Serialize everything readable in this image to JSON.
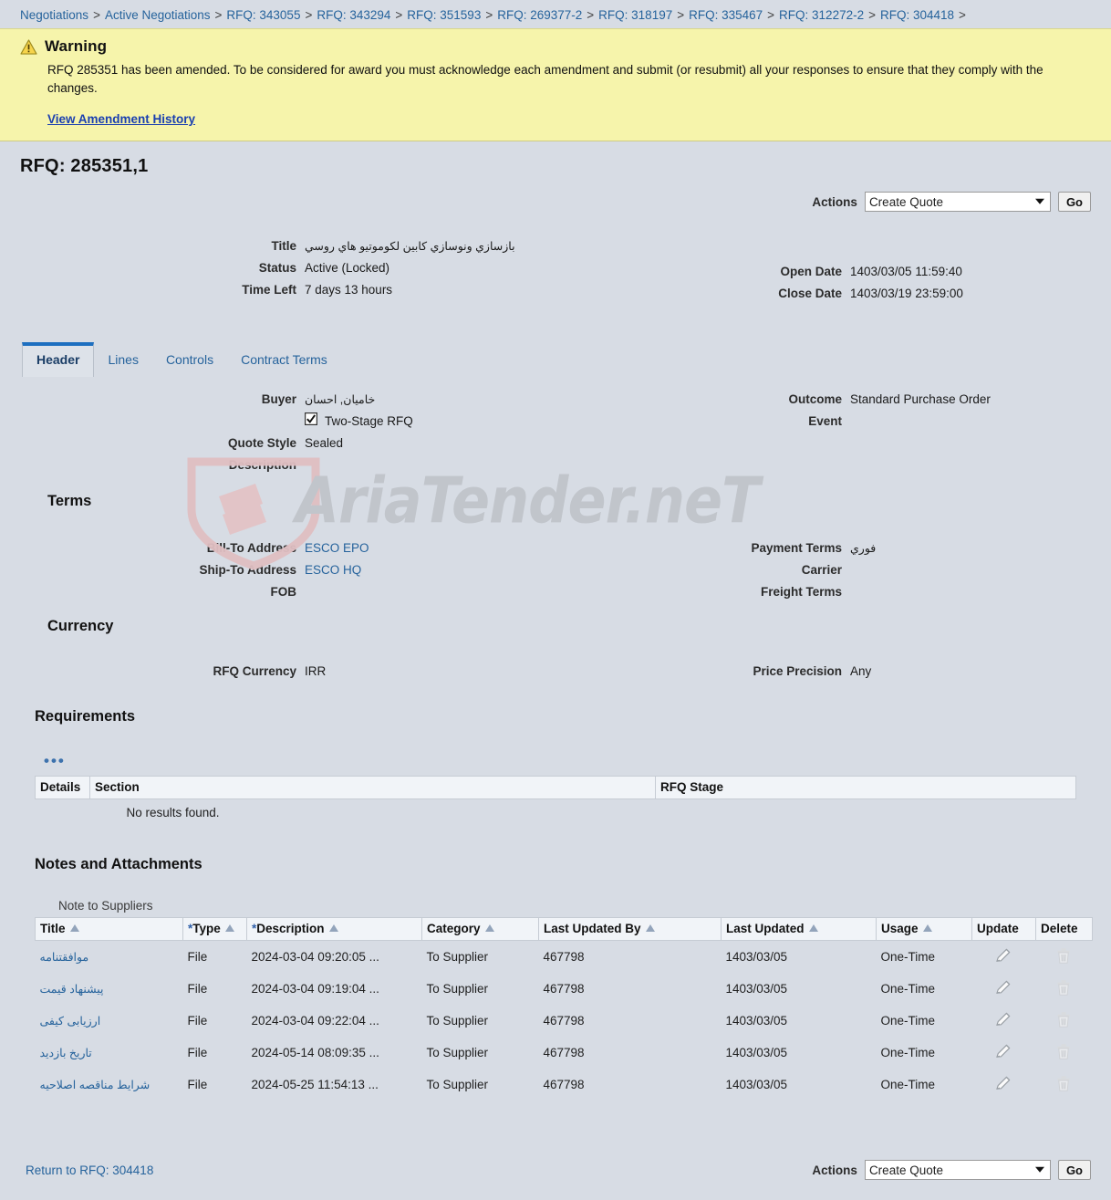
{
  "breadcrumb": {
    "separator": ">",
    "items": [
      "Negotiations",
      "Active Negotiations",
      "RFQ: 343055",
      "RFQ: 343294",
      "RFQ: 351593",
      "RFQ: 269377-2",
      "RFQ: 318197",
      "RFQ: 335467",
      "RFQ: 312272-2",
      "RFQ: 304418"
    ]
  },
  "warning": {
    "icon": "warning-triangle-icon",
    "title": "Warning",
    "message": "RFQ 285351 has been amended. To be considered for award you must acknowledge each amendment and submit (or resubmit) all your responses to ensure that they comply with the changes.",
    "link": "View Amendment History",
    "bg_color": "#f6f4ab"
  },
  "page": {
    "title": "RFQ: 285351,1",
    "bg_color": "#d7dce4",
    "link_color": "#26639c",
    "accent_color": "#1d6fc0"
  },
  "actions_top": {
    "label": "Actions",
    "selected": "Create Quote",
    "options": [
      "Create Quote"
    ],
    "go_label": "Go"
  },
  "actions_bottom": {
    "label": "Actions",
    "selected": "Create Quote",
    "options": [
      "Create Quote"
    ],
    "go_label": "Go"
  },
  "summary": {
    "left": [
      {
        "label": "Title",
        "value": "بازسازي ونوسازي كابين لكوموتيو هاي روسي",
        "rtl": true
      },
      {
        "label": "Status",
        "value": "Active (Locked)",
        "rtl": false
      },
      {
        "label": "Time Left",
        "value": "7 days 13 hours",
        "rtl": false
      }
    ],
    "right": [
      {
        "label": "Open Date",
        "value": "1403/03/05 11:59:40"
      },
      {
        "label": "Close Date",
        "value": "1403/03/19 23:59:00"
      }
    ]
  },
  "tabs": [
    {
      "label": "Header",
      "active": true
    },
    {
      "label": "Lines",
      "active": false
    },
    {
      "label": "Controls",
      "active": false
    },
    {
      "label": "Contract Terms",
      "active": false
    }
  ],
  "header_tab": {
    "left": [
      {
        "label": "Buyer",
        "value": "خامیان, احسان",
        "rtl": true
      },
      {
        "label": "Quote Style",
        "value": "Sealed",
        "rtl": false
      },
      {
        "label": "Description",
        "value": "",
        "rtl": false
      }
    ],
    "two_stage": {
      "label": "Two-Stage RFQ",
      "checked": true
    },
    "right": [
      {
        "label": "Outcome",
        "value": "Standard Purchase Order"
      },
      {
        "label": "Event",
        "value": ""
      }
    ]
  },
  "terms": {
    "heading": "Terms",
    "left": [
      {
        "label": "Bill-To Address",
        "value": "ESCO EPO",
        "link": true
      },
      {
        "label": "Ship-To Address",
        "value": "ESCO HQ",
        "link": true
      },
      {
        "label": "FOB",
        "value": "",
        "link": false
      }
    ],
    "right": [
      {
        "label": "Payment Terms",
        "value": "فوري",
        "rtl": true
      },
      {
        "label": "Carrier",
        "value": "",
        "rtl": false
      },
      {
        "label": "Freight Terms",
        "value": "",
        "rtl": false
      }
    ]
  },
  "currency": {
    "heading": "Currency",
    "left": [
      {
        "label": "RFQ Currency",
        "value": "IRR"
      }
    ],
    "right": [
      {
        "label": "Price Precision",
        "value": "Any"
      }
    ]
  },
  "requirements": {
    "heading": "Requirements",
    "more_icon": "ellipsis-icon",
    "columns": [
      "Details",
      "Section",
      "RFQ Stage"
    ],
    "empty_text": "No results found."
  },
  "notes": {
    "heading": "Notes and Attachments",
    "subheading": "Note to Suppliers",
    "columns": [
      {
        "label": "Title",
        "sortable": true,
        "required": false
      },
      {
        "label": "Type",
        "sortable": true,
        "required": true
      },
      {
        "label": "Description",
        "sortable": true,
        "required": true
      },
      {
        "label": "Category",
        "sortable": true,
        "required": false
      },
      {
        "label": "Last Updated By",
        "sortable": true,
        "required": false
      },
      {
        "label": "Last Updated",
        "sortable": true,
        "required": false
      },
      {
        "label": "Usage",
        "sortable": true,
        "required": false
      },
      {
        "label": "Update",
        "sortable": false,
        "required": false
      },
      {
        "label": "Delete",
        "sortable": false,
        "required": false
      }
    ],
    "rows": [
      {
        "title": "موافقتنامه",
        "type": "File",
        "description": "2024-03-04 09:20:05 ...",
        "category": "To Supplier",
        "last_updated_by": "467798",
        "last_updated": "1403/03/05",
        "usage": "One-Time",
        "update_icon": "pencil-icon",
        "delete_icon": "trash-icon"
      },
      {
        "title": "پیشنهاد قیمت",
        "type": "File",
        "description": "2024-03-04 09:19:04 ...",
        "category": "To Supplier",
        "last_updated_by": "467798",
        "last_updated": "1403/03/05",
        "usage": "One-Time",
        "update_icon": "pencil-icon",
        "delete_icon": "trash-icon"
      },
      {
        "title": "ارزیابی کیفی",
        "type": "File",
        "description": "2024-03-04 09:22:04 ...",
        "category": "To Supplier",
        "last_updated_by": "467798",
        "last_updated": "1403/03/05",
        "usage": "One-Time",
        "update_icon": "pencil-icon",
        "delete_icon": "trash-icon"
      },
      {
        "title": "تاریخ بازدید",
        "type": "File",
        "description": "2024-05-14 08:09:35 ...",
        "category": "To Supplier",
        "last_updated_by": "467798",
        "last_updated": "1403/03/05",
        "usage": "One-Time",
        "update_icon": "pencil-icon",
        "delete_icon": "trash-icon"
      },
      {
        "title": "شرایط مناقصه اصلاحیه",
        "type": "File",
        "description": "2024-05-25 11:54:13 ...",
        "category": "To Supplier",
        "last_updated_by": "467798",
        "last_updated": "1403/03/05",
        "usage": "One-Time",
        "update_icon": "pencil-icon",
        "delete_icon": "trash-icon"
      }
    ]
  },
  "footer": {
    "return_link": "Return to RFQ: 304418"
  },
  "watermark": {
    "text": "AriaTender.neT",
    "logo": "shield-logo",
    "color": "#c0c4ca"
  }
}
